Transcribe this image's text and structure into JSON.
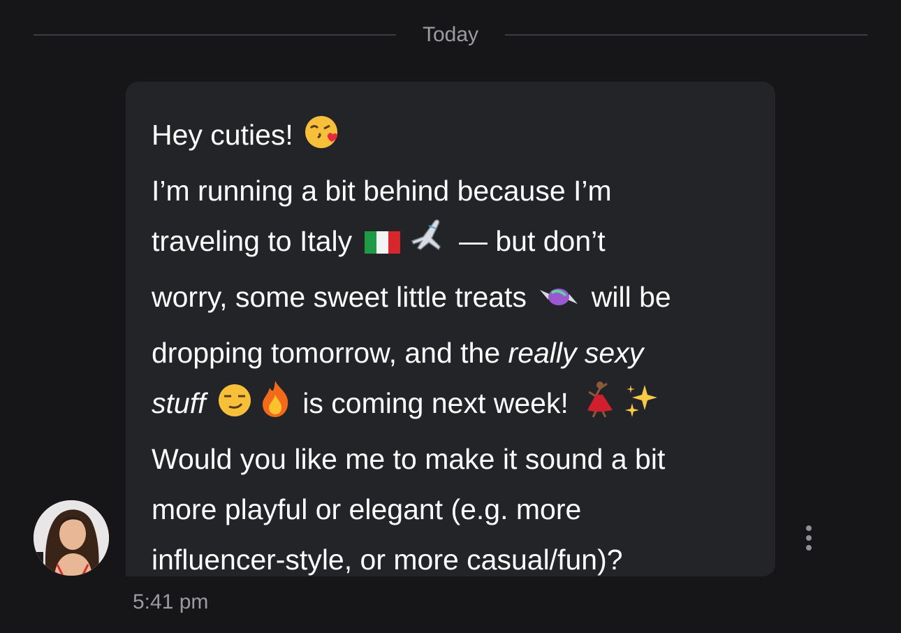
{
  "date_divider": {
    "label": "Today"
  },
  "message": {
    "line1": "Hey cuties!",
    "line2": "I’m running a bit behind because I’m",
    "line3_a": "traveling to Italy",
    "line3_b": "— but don’t",
    "line4_a": "worry, some sweet little treats",
    "line4_b": "will be",
    "line5_a": "dropping tomorrow, and the ",
    "line5_b": "really sexy",
    "line6_a": "stuff",
    "line6_b": "is coming next week!",
    "line7": "Would you like me to make it sound a bit",
    "line8": "more playful or elegant (e.g. more",
    "line9": "influencer-style, or more casual/fun)?",
    "timestamp": "5:41 pm"
  },
  "icons": {
    "kiss": "face-blowing-kiss-icon",
    "flag": "italy-flag-icon",
    "plane": "airplane-icon",
    "candy": "candy-icon",
    "smirk": "smirking-face-icon",
    "fire": "fire-icon",
    "dancer": "dancer-icon",
    "sparkles": "sparkles-icon",
    "more": "more-vertical-icon"
  },
  "colors": {
    "background": "#161618",
    "bubble": "#232427",
    "muted_text": "#9a9ca1",
    "divider": "#3a3d42"
  }
}
